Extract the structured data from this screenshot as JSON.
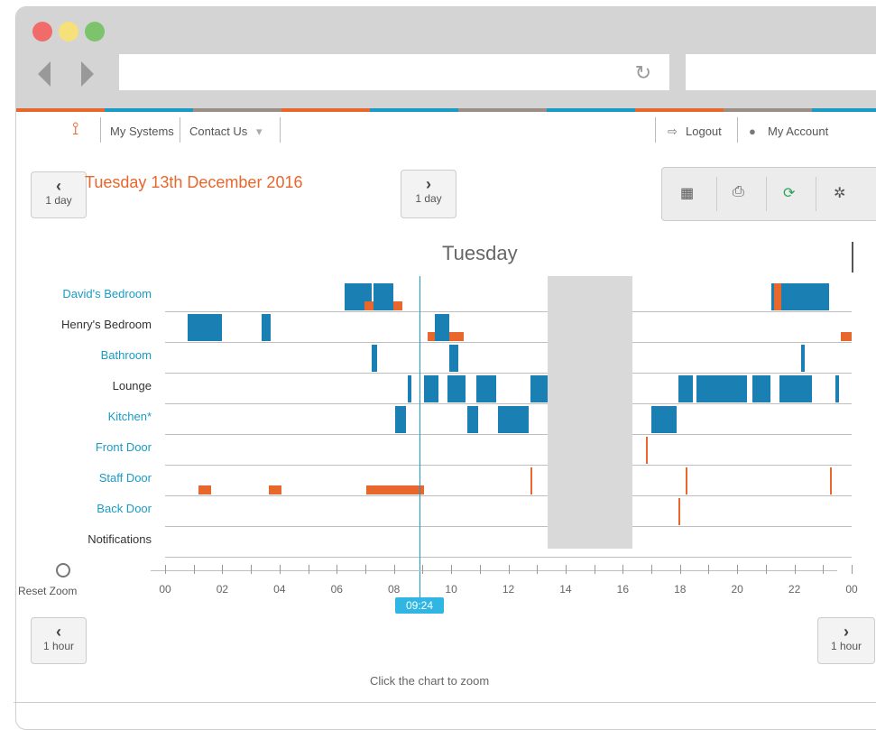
{
  "browser": {
    "reload_icon": "reload-icon"
  },
  "topnav": {
    "logo_icon": "network-logo-icon",
    "my_systems": "My Systems",
    "contact_us": "Contact Us",
    "logout": "Logout",
    "my_account": "My Account"
  },
  "date_nav": {
    "prev_day": "1 day",
    "next_day": "1 day",
    "title": "Tuesday 13th December 2016"
  },
  "toolbar": {
    "calendar_icon": "calendar-icon",
    "print_icon": "print-icon",
    "refresh_icon": "refresh-icon",
    "settings_icon": "gear-icon"
  },
  "chart": {
    "day": "Tuesday",
    "rows": [
      {
        "label": "David's Bedroom",
        "link": true
      },
      {
        "label": "Henry's Bedroom",
        "link": false
      },
      {
        "label": "Bathroom",
        "link": true
      },
      {
        "label": "Lounge",
        "link": false
      },
      {
        "label": "Kitchen*",
        "link": true
      },
      {
        "label": "Front Door",
        "link": true
      },
      {
        "label": "Staff Door",
        "link": true
      },
      {
        "label": "Back Door",
        "link": true
      },
      {
        "label": "Notifications",
        "link": false
      }
    ],
    "ticks": [
      "00",
      "02",
      "04",
      "06",
      "08",
      "10",
      "12",
      "14",
      "16",
      "18",
      "20",
      "22",
      "00"
    ],
    "now": "09:24",
    "reset_zoom": "Reset Zoom",
    "hint": "Click the chart to zoom"
  },
  "hour_nav": {
    "prev_hour": "1 hour",
    "next_hour": "1 hour"
  },
  "colors": {
    "blue": "#1a7fb3",
    "orange": "#e8672d",
    "accent_text": "#e8672d",
    "link": "#1a9bc5"
  }
}
